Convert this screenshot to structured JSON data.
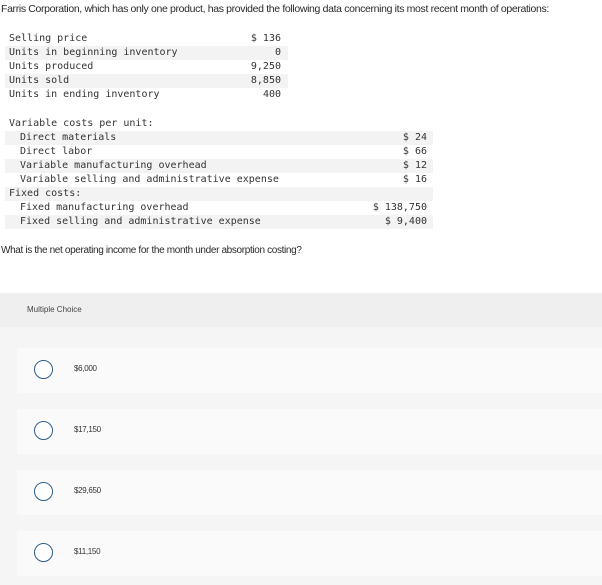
{
  "intro_text": "Farris Corporation, which has only one product, has provided the following data concerning its most recent month of operations:",
  "basic_data": {
    "rows": [
      {
        "label": "Selling price",
        "value": "$ 136"
      },
      {
        "label": "Units in beginning inventory",
        "value": "0"
      },
      {
        "label": "Units produced",
        "value": "9,250"
      },
      {
        "label": "Units sold",
        "value": "8,850"
      },
      {
        "label": "Units in ending inventory",
        "value": "400"
      }
    ]
  },
  "cost_data": {
    "variable_header": "Variable costs per unit:",
    "variable_rows": [
      {
        "label": "Direct materials",
        "value": "$ 24"
      },
      {
        "label": "Direct labor",
        "value": "$ 66"
      },
      {
        "label": "Variable manufacturing overhead",
        "value": "$ 12"
      },
      {
        "label": "Variable selling and administrative expense",
        "value": "$ 16"
      }
    ],
    "fixed_header": "Fixed costs:",
    "fixed_rows": [
      {
        "label": "Fixed manufacturing overhead",
        "value": "$ 138,750"
      },
      {
        "label": "Fixed selling and administrative expense",
        "value": "$ 9,400"
      }
    ]
  },
  "question": "What is the net operating income for the month under absorption costing?",
  "multiple_choice": {
    "header": "Multiple Choice",
    "options": [
      {
        "label": "$6,000",
        "selected": false
      },
      {
        "label": "$17,150",
        "selected": false
      },
      {
        "label": "$29,650",
        "selected": false
      },
      {
        "label": "$11,150",
        "selected": false
      }
    ]
  },
  "colors": {
    "radio_border": "#2e5d8c",
    "row_shade": "#f3f3f3",
    "mc_header_bg": "#efefef",
    "mc_body_bg": "#f5f5f5",
    "option_bg": "#fafafa"
  }
}
